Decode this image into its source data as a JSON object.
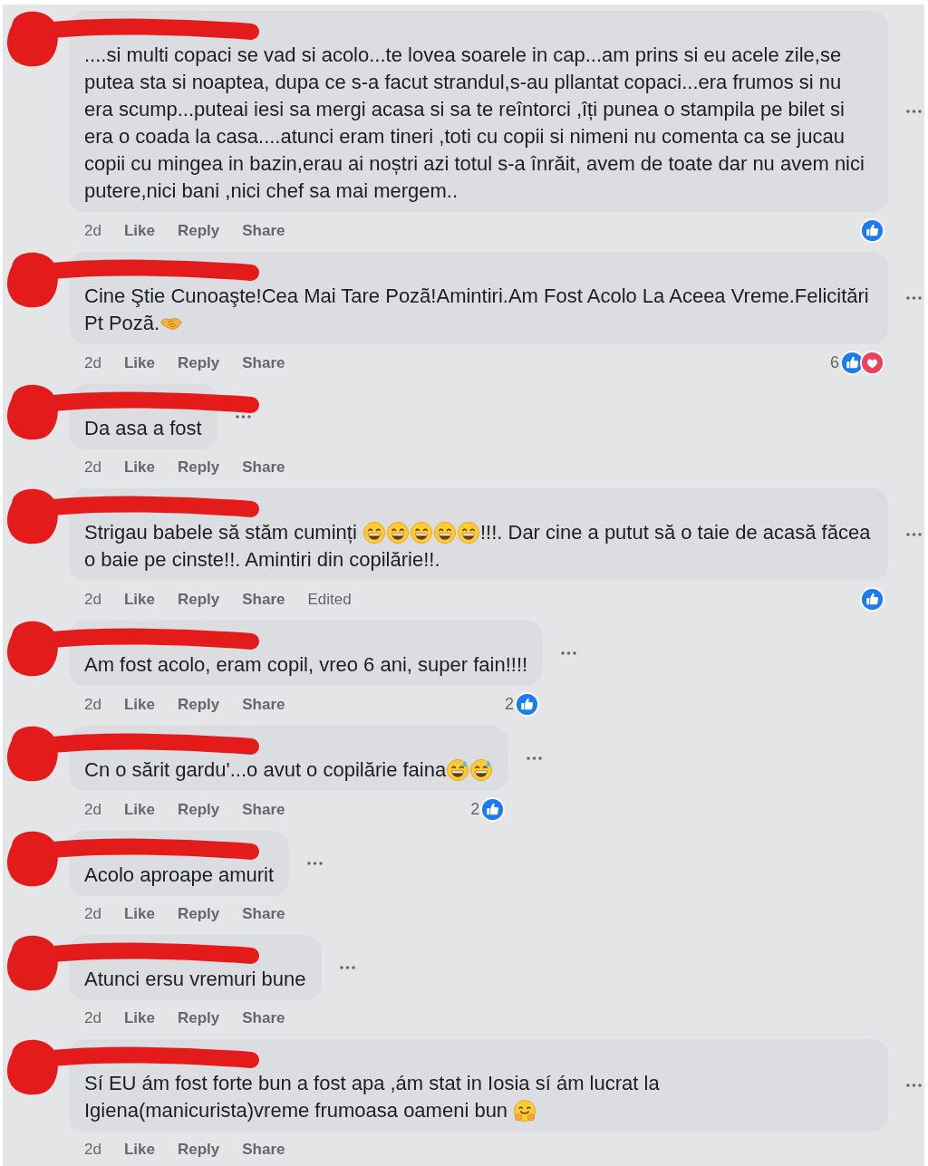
{
  "comments": [
    {
      "redacted": true,
      "body": [
        {
          "kind": "text",
          "text": "....si multi copaci se vad si acolo...te lovea soarele in cap...am prins si eu acele zile,se putea sta si noaptea, dupa ce s-a facut strandul,s-au pllantat copaci...era frumos si nu era scump...puteai iesi sa mergi acasa si sa te reîntorci ,îți punea o stampila pe bilet si era o coada la casa....atunci eram tineri ,toti cu copii si nimeni nu comenta ca se jucau copii cu mingea in bazin,erau ai noștri azi totul s-a înrăit, avem de toate dar nu avem nici putere,nici bani ,nici chef sa mai mergem.."
        }
      ],
      "time": "2d",
      "actions": [
        "Like",
        "Reply",
        "Share"
      ],
      "reactions": {
        "items": [
          {
            "kind": "like"
          }
        ]
      }
    },
    {
      "redacted": true,
      "body": [
        {
          "kind": "text",
          "text": "Cine Ştie Cunoaşte!Cea Mai Tare Pozã!Amintiri.Am Fost Acolo La Aceea Vreme.Felicitări Pt Pozã."
        },
        {
          "kind": "handshake"
        }
      ],
      "time": "2d",
      "actions": [
        "Like",
        "Reply",
        "Share"
      ],
      "reactions": {
        "count": "6",
        "items": [
          {
            "kind": "like"
          },
          {
            "kind": "love"
          }
        ]
      }
    },
    {
      "redacted": true,
      "body": [
        {
          "kind": "text",
          "text": "Da asa a fost"
        }
      ],
      "time": "2d",
      "actions": [
        "Like",
        "Reply",
        "Share"
      ]
    },
    {
      "redacted": true,
      "body": [
        {
          "kind": "text",
          "text": "Strigau babele să stăm cuminți "
        },
        {
          "kind": "grin"
        },
        {
          "kind": "grin"
        },
        {
          "kind": "grin"
        },
        {
          "kind": "grin"
        },
        {
          "kind": "grin"
        },
        {
          "kind": "text",
          "text": "!!!. Dar cine a putut să o taie de acasă făcea o baie pe cinste!!. Amintiri din copilărie!!."
        }
      ],
      "time": "2d",
      "actions": [
        "Like",
        "Reply",
        "Share"
      ],
      "status": "Edited",
      "reactions": {
        "items": [
          {
            "kind": "like"
          }
        ]
      }
    },
    {
      "redacted": true,
      "body": [
        {
          "kind": "text",
          "text": "Am fost acolo, eram copil, vreo 6 ani, super fain!!!!"
        }
      ],
      "time": "2d",
      "actions": [
        "Like",
        "Reply",
        "Share"
      ],
      "reactions": {
        "count": "2",
        "items": [
          {
            "kind": "like"
          }
        ]
      }
    },
    {
      "redacted": true,
      "body": [
        {
          "kind": "text",
          "text": "Cn o sărit gardu'...o avut o copilărie faina"
        },
        {
          "kind": "sweat"
        },
        {
          "kind": "sweat"
        }
      ],
      "time": "2d",
      "actions": [
        "Like",
        "Reply",
        "Share"
      ],
      "reactions": {
        "count": "2",
        "items": [
          {
            "kind": "like"
          }
        ]
      }
    },
    {
      "redacted": true,
      "body": [
        {
          "kind": "text",
          "text": "Acolo aproape amurit"
        }
      ],
      "time": "2d",
      "actions": [
        "Like",
        "Reply",
        "Share"
      ]
    },
    {
      "redacted": true,
      "body": [
        {
          "kind": "text",
          "text": "Atunci ersu vremuri bune"
        }
      ],
      "time": "2d",
      "actions": [
        "Like",
        "Reply",
        "Share"
      ]
    },
    {
      "redacted": true,
      "body": [
        {
          "kind": "text",
          "text": "Sí EU ám fost forte bun a fost apa ,ám stat in Iosia sí ám lucrat la Igiena(manicurista)vreme frumoasa oameni bun "
        },
        {
          "kind": "hug"
        }
      ],
      "time": "2d",
      "actions": [
        "Like",
        "Reply",
        "Share"
      ]
    }
  ]
}
